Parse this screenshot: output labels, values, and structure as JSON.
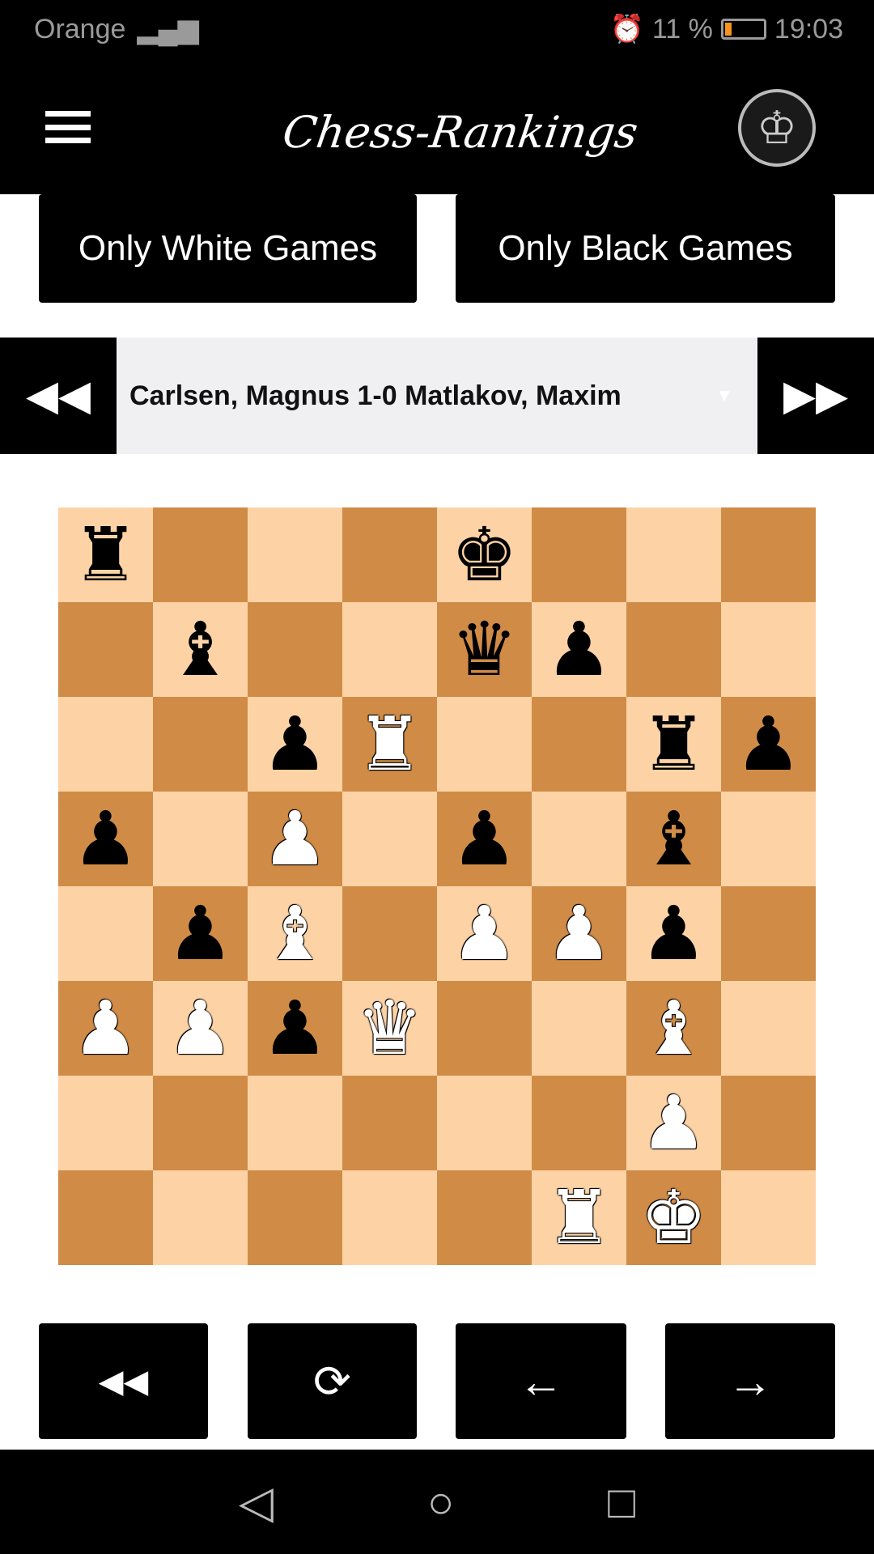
{
  "status_bar": {
    "carrier": "Orange",
    "battery": "11 %",
    "battery_level": 11,
    "time": "19:03"
  },
  "header": {
    "logo_text": "Chess-Rankings",
    "menu_icon": "hamburger-icon",
    "avatar_icon": "crown-icon"
  },
  "filters": {
    "white": "Only White Games",
    "black": "Only Black Games"
  },
  "game": {
    "selected": "Carlsen, Magnus 1-0 Matlakov, Maxim",
    "prev_icon": "⏪",
    "next_icon": "⏩",
    "caret": "▼"
  },
  "board": {
    "colors": {
      "light": "#fdd3a6",
      "dark": "#d08c46"
    },
    "ranks": [
      [
        "r",
        "",
        "",
        "",
        "k",
        "",
        "",
        ""
      ],
      [
        "",
        "b",
        "",
        "",
        "q",
        "p",
        "",
        ""
      ],
      [
        "",
        "",
        "p",
        "R",
        "",
        "",
        "r",
        "p"
      ],
      [
        "p",
        "",
        "P",
        "",
        "p",
        "",
        "b",
        ""
      ],
      [
        "",
        "p",
        "B",
        "",
        "P",
        "P",
        "p",
        ""
      ],
      [
        "P",
        "P",
        "p",
        "Q",
        "",
        "",
        "B",
        ""
      ],
      [
        "",
        "",
        "",
        "",
        "",
        "",
        "P",
        ""
      ],
      [
        "",
        "",
        "",
        "",
        "",
        "R",
        "K",
        ""
      ]
    ]
  },
  "controls": {
    "first": "⏪",
    "flip": "⟳",
    "back": "←",
    "forward": "→"
  },
  "nav": {
    "back": "◁",
    "home": "○",
    "recent": "□"
  }
}
